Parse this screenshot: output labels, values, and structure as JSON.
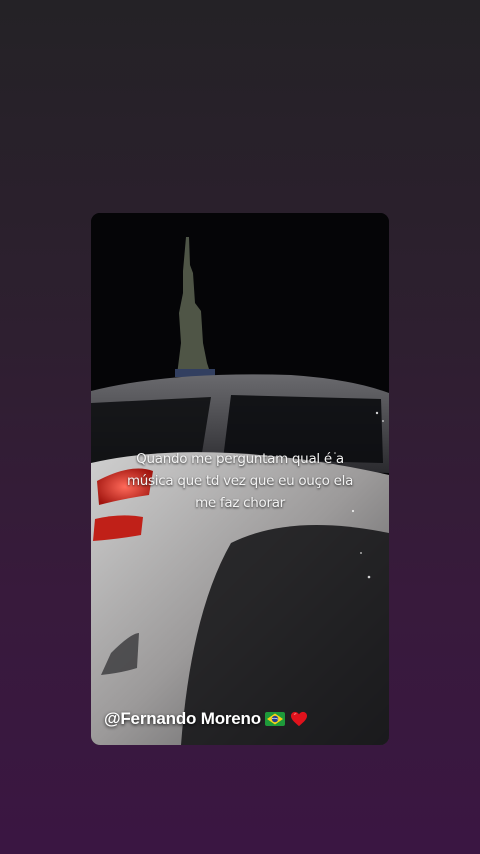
{
  "story": {
    "caption_lines": [
      "Quando me perguntam qual é a",
      "música que td vez que eu ouço ela",
      "me faz chorar"
    ],
    "handle": "@Fernando Moreno",
    "emoji_icons": [
      "brazil-flag-icon",
      "red-heart-icon"
    ]
  },
  "colors": {
    "background_top": "#242226",
    "background_bottom": "#3a1642",
    "card_background": "#050507",
    "caption_text": "#f3f3f3",
    "handle_text": "#ffffff"
  }
}
